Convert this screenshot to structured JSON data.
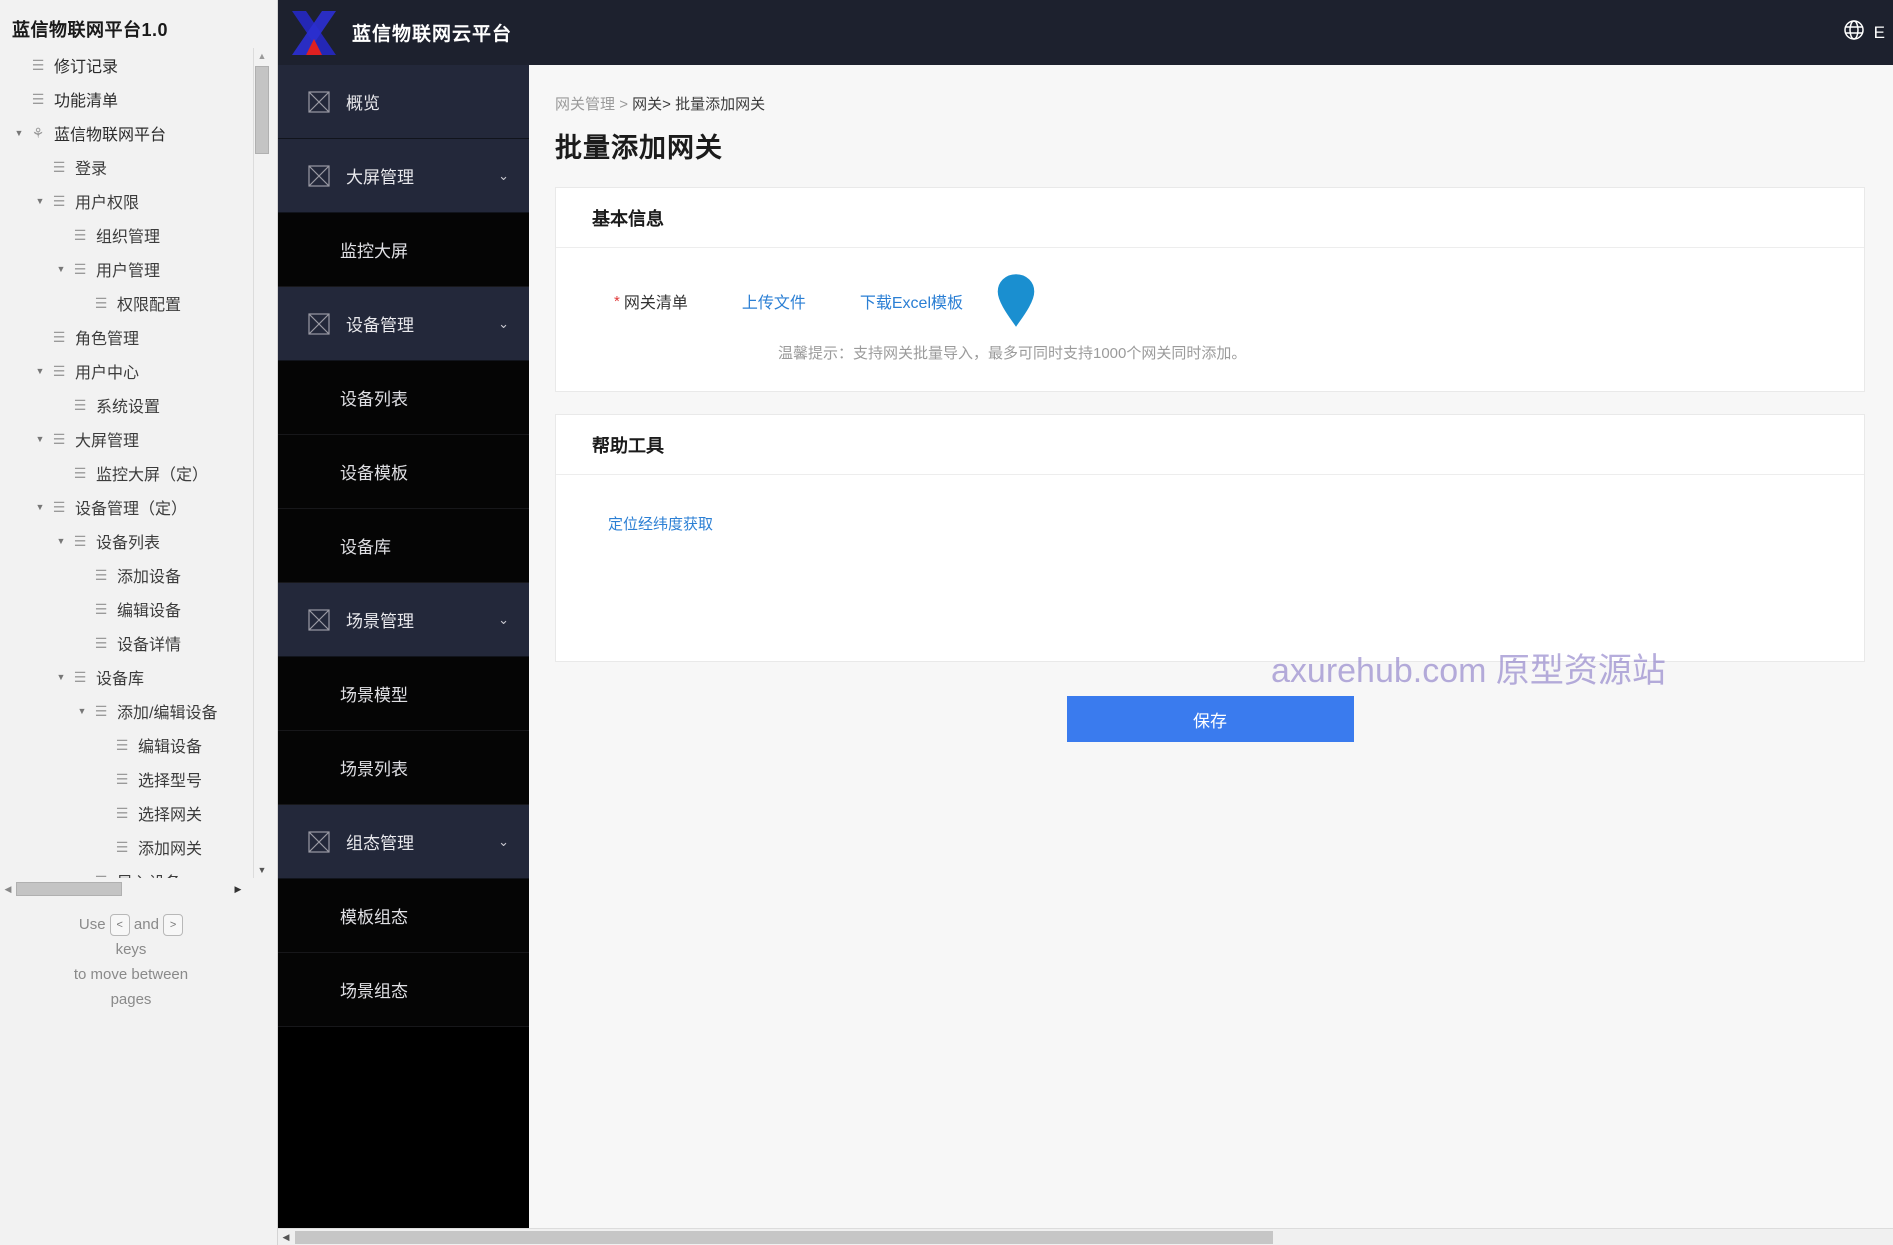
{
  "axure_panel": {
    "title": "蓝信物联网平台1.0",
    "tree": [
      {
        "label": "修订记录",
        "depth": 0,
        "caret": "",
        "icon": "page-icon"
      },
      {
        "label": "功能清单",
        "depth": 0,
        "caret": "",
        "icon": "page-icon"
      },
      {
        "label": "蓝信物联网平台",
        "depth": 0,
        "caret": "▼",
        "icon": "folder-people-icon"
      },
      {
        "label": "登录",
        "depth": 1,
        "caret": "",
        "icon": "page-icon"
      },
      {
        "label": "用户权限",
        "depth": 1,
        "caret": "▼",
        "icon": "page-icon"
      },
      {
        "label": "组织管理",
        "depth": 2,
        "caret": "",
        "icon": "page-icon"
      },
      {
        "label": "用户管理",
        "depth": 2,
        "caret": "▼",
        "icon": "page-icon"
      },
      {
        "label": "权限配置",
        "depth": 3,
        "caret": "",
        "icon": "page-icon"
      },
      {
        "label": "角色管理",
        "depth": 1,
        "caret": "",
        "icon": "page-icon"
      },
      {
        "label": "用户中心",
        "depth": 1,
        "caret": "▼",
        "icon": "page-icon"
      },
      {
        "label": "系统设置",
        "depth": 2,
        "caret": "",
        "icon": "page-icon"
      },
      {
        "label": "大屏管理",
        "depth": 1,
        "caret": "▼",
        "icon": "page-icon"
      },
      {
        "label": "监控大屏（定）",
        "depth": 2,
        "caret": "",
        "icon": "page-icon"
      },
      {
        "label": "设备管理（定）",
        "depth": 1,
        "caret": "▼",
        "icon": "page-icon"
      },
      {
        "label": "设备列表",
        "depth": 2,
        "caret": "▼",
        "icon": "page-icon"
      },
      {
        "label": "添加设备",
        "depth": 3,
        "caret": "",
        "icon": "page-icon"
      },
      {
        "label": "编辑设备",
        "depth": 3,
        "caret": "",
        "icon": "page-icon"
      },
      {
        "label": "设备详情",
        "depth": 3,
        "caret": "",
        "icon": "page-icon"
      },
      {
        "label": "设备库",
        "depth": 2,
        "caret": "▼",
        "icon": "page-icon"
      },
      {
        "label": "添加/编辑设备",
        "depth": 3,
        "caret": "▼",
        "icon": "page-icon"
      },
      {
        "label": "编辑设备",
        "depth": 4,
        "caret": "",
        "icon": "page-icon"
      },
      {
        "label": "选择型号",
        "depth": 4,
        "caret": "",
        "icon": "page-icon"
      },
      {
        "label": "选择网关",
        "depth": 4,
        "caret": "",
        "icon": "page-icon"
      },
      {
        "label": "添加网关",
        "depth": 4,
        "caret": "",
        "icon": "page-icon"
      },
      {
        "label": "导入设备",
        "depth": 3,
        "caret": "▼",
        "icon": "page-icon"
      }
    ],
    "hint_prefix": "Use",
    "hint_key_prev": "<",
    "hint_key_next": ">",
    "hint_and": "and",
    "hint_line2": "keys",
    "hint_line3": "to move between",
    "hint_line4": "pages"
  },
  "topbar": {
    "brand_name": "蓝信物联网云平台",
    "lang_label": "E",
    "globe_icon": "globe-icon",
    "logo_icon": "brand-logo-icon"
  },
  "sidenav": {
    "items": [
      {
        "type": "group",
        "label": "概览",
        "icon": "placeholder-box-icon",
        "chevron": ""
      },
      {
        "type": "group",
        "label": "大屏管理",
        "icon": "placeholder-box-icon",
        "chevron": "⌄"
      },
      {
        "type": "sub",
        "label": "监控大屏"
      },
      {
        "type": "group",
        "label": "设备管理",
        "icon": "placeholder-box-icon",
        "chevron": "⌄"
      },
      {
        "type": "sub",
        "label": "设备列表"
      },
      {
        "type": "sub",
        "label": "设备模板"
      },
      {
        "type": "sub",
        "label": "设备库"
      },
      {
        "type": "group",
        "label": "场景管理",
        "icon": "placeholder-box-icon",
        "chevron": "⌄"
      },
      {
        "type": "sub",
        "label": "场景模型"
      },
      {
        "type": "sub",
        "label": "场景列表"
      },
      {
        "type": "group",
        "label": "组态管理",
        "icon": "placeholder-box-icon",
        "chevron": "⌄"
      },
      {
        "type": "sub",
        "label": "模板组态"
      },
      {
        "type": "sub",
        "label": "场景组态"
      }
    ]
  },
  "main": {
    "breadcrumb": {
      "item1": "网关管理",
      "sep1": ">",
      "item2": "网关>",
      "item3": "批量添加网关"
    },
    "page_title": "批量添加网关",
    "basic_card": {
      "heading": "基本信息",
      "required_star": "*",
      "field_label": "网关清单",
      "upload_link": "上传文件",
      "template_link": "下载Excel模板",
      "pin_icon": "map-pin-icon",
      "tip": "温馨提示：支持网关批量导入，最多可同时支持1000个网关同时添加。"
    },
    "help_card": {
      "heading": "帮助工具",
      "link": "定位经纬度获取"
    },
    "save_label": "保存",
    "watermark": "axurehub.com 原型资源站"
  },
  "colors": {
    "accent_blue": "#3a7bee",
    "link_blue": "#2b7fd4",
    "topbar_dark": "#1d212e",
    "nav_group_dark": "#23283a",
    "nav_sub_dark": "#050505",
    "required_red": "#e03a3a",
    "pin_blue": "#1a8fd0",
    "watermark_purple": "#8b7cc8"
  }
}
